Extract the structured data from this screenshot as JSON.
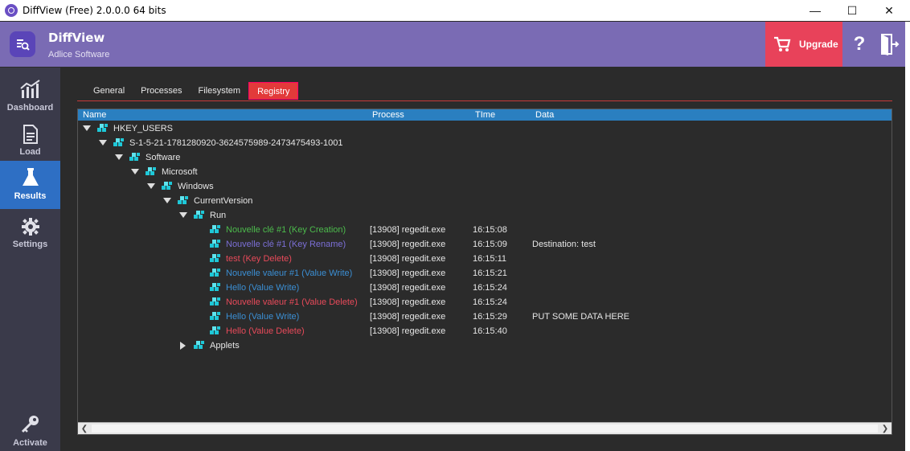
{
  "window": {
    "title": "DiffView (Free) 2.0.0.0 64 bits"
  },
  "header": {
    "app_name": "DiffView",
    "company": "Adlice Software",
    "upgrade_label": "Upgrade",
    "help_label": "?"
  },
  "sidebar": {
    "items": [
      {
        "label": "Dashboard"
      },
      {
        "label": "Load"
      },
      {
        "label": "Results"
      },
      {
        "label": "Settings"
      },
      {
        "label": "Activate"
      }
    ]
  },
  "tabs": [
    {
      "label": "General"
    },
    {
      "label": "Processes"
    },
    {
      "label": "Filesystem"
    },
    {
      "label": "Registry"
    }
  ],
  "columns": {
    "name": "Name",
    "process": "Process",
    "time": "TIme",
    "data": "Data"
  },
  "tree": {
    "hkey_users": "HKEY_USERS",
    "sid": "S-1-5-21-1781280920-3624575989-2473475493-1001",
    "software": "Software",
    "microsoft": "Microsoft",
    "windows": "Windows",
    "currentversion": "CurrentVersion",
    "run": "Run",
    "applets": "Applets",
    "entries": [
      {
        "name": "Nouvelle clé #1 (Key Creation)",
        "process": "[13908] regedit.exe",
        "time": "16:15:08",
        "data": "",
        "color": "#4cbb4c"
      },
      {
        "name": "Nouvelle clé #1 (Key Rename)",
        "process": "[13908] regedit.exe",
        "time": "16:15:09",
        "data": "Destination: test",
        "color": "#7b6fd6"
      },
      {
        "name": "test (Key Delete)",
        "process": "[13908] regedit.exe",
        "time": "16:15:11",
        "data": "",
        "color": "#e84a5a"
      },
      {
        "name": "Nouvelle valeur #1 (Value Write)",
        "process": "[13908] regedit.exe",
        "time": "16:15:21",
        "data": "",
        "color": "#3b8fd4"
      },
      {
        "name": "Hello (Value Write)",
        "process": "[13908] regedit.exe",
        "time": "16:15:24",
        "data": "",
        "color": "#3b8fd4"
      },
      {
        "name": "Nouvelle valeur #1 (Value Delete)",
        "process": "[13908] regedit.exe",
        "time": "16:15:24",
        "data": "",
        "color": "#e84a5a"
      },
      {
        "name": "Hello (Value Write)",
        "process": "[13908] regedit.exe",
        "time": "16:15:29",
        "data": "PUT SOME DATA HERE",
        "color": "#3b8fd4"
      },
      {
        "name": "Hello (Value Delete)",
        "process": "[13908] regedit.exe",
        "time": "16:15:40",
        "data": "",
        "color": "#e84a5a"
      }
    ]
  },
  "colors": {
    "header_bg": "#7a6bb4",
    "sidebar_bg": "#3a3a4a",
    "active_sidebar": "#2e6fc4",
    "upgrade_bg": "#e8425a",
    "active_tab": "#e23a3a",
    "column_header": "#2a7fc0",
    "registry_icon": "#1ec8d8"
  },
  "icons": {
    "registry_node": "registry-cubes-icon",
    "dashboard": "chart-trend-icon",
    "load": "document-icon",
    "results": "flask-icon",
    "settings": "gear-icon",
    "activate": "key-icon",
    "upgrade": "cart-icon",
    "exit": "exit-door-icon"
  }
}
